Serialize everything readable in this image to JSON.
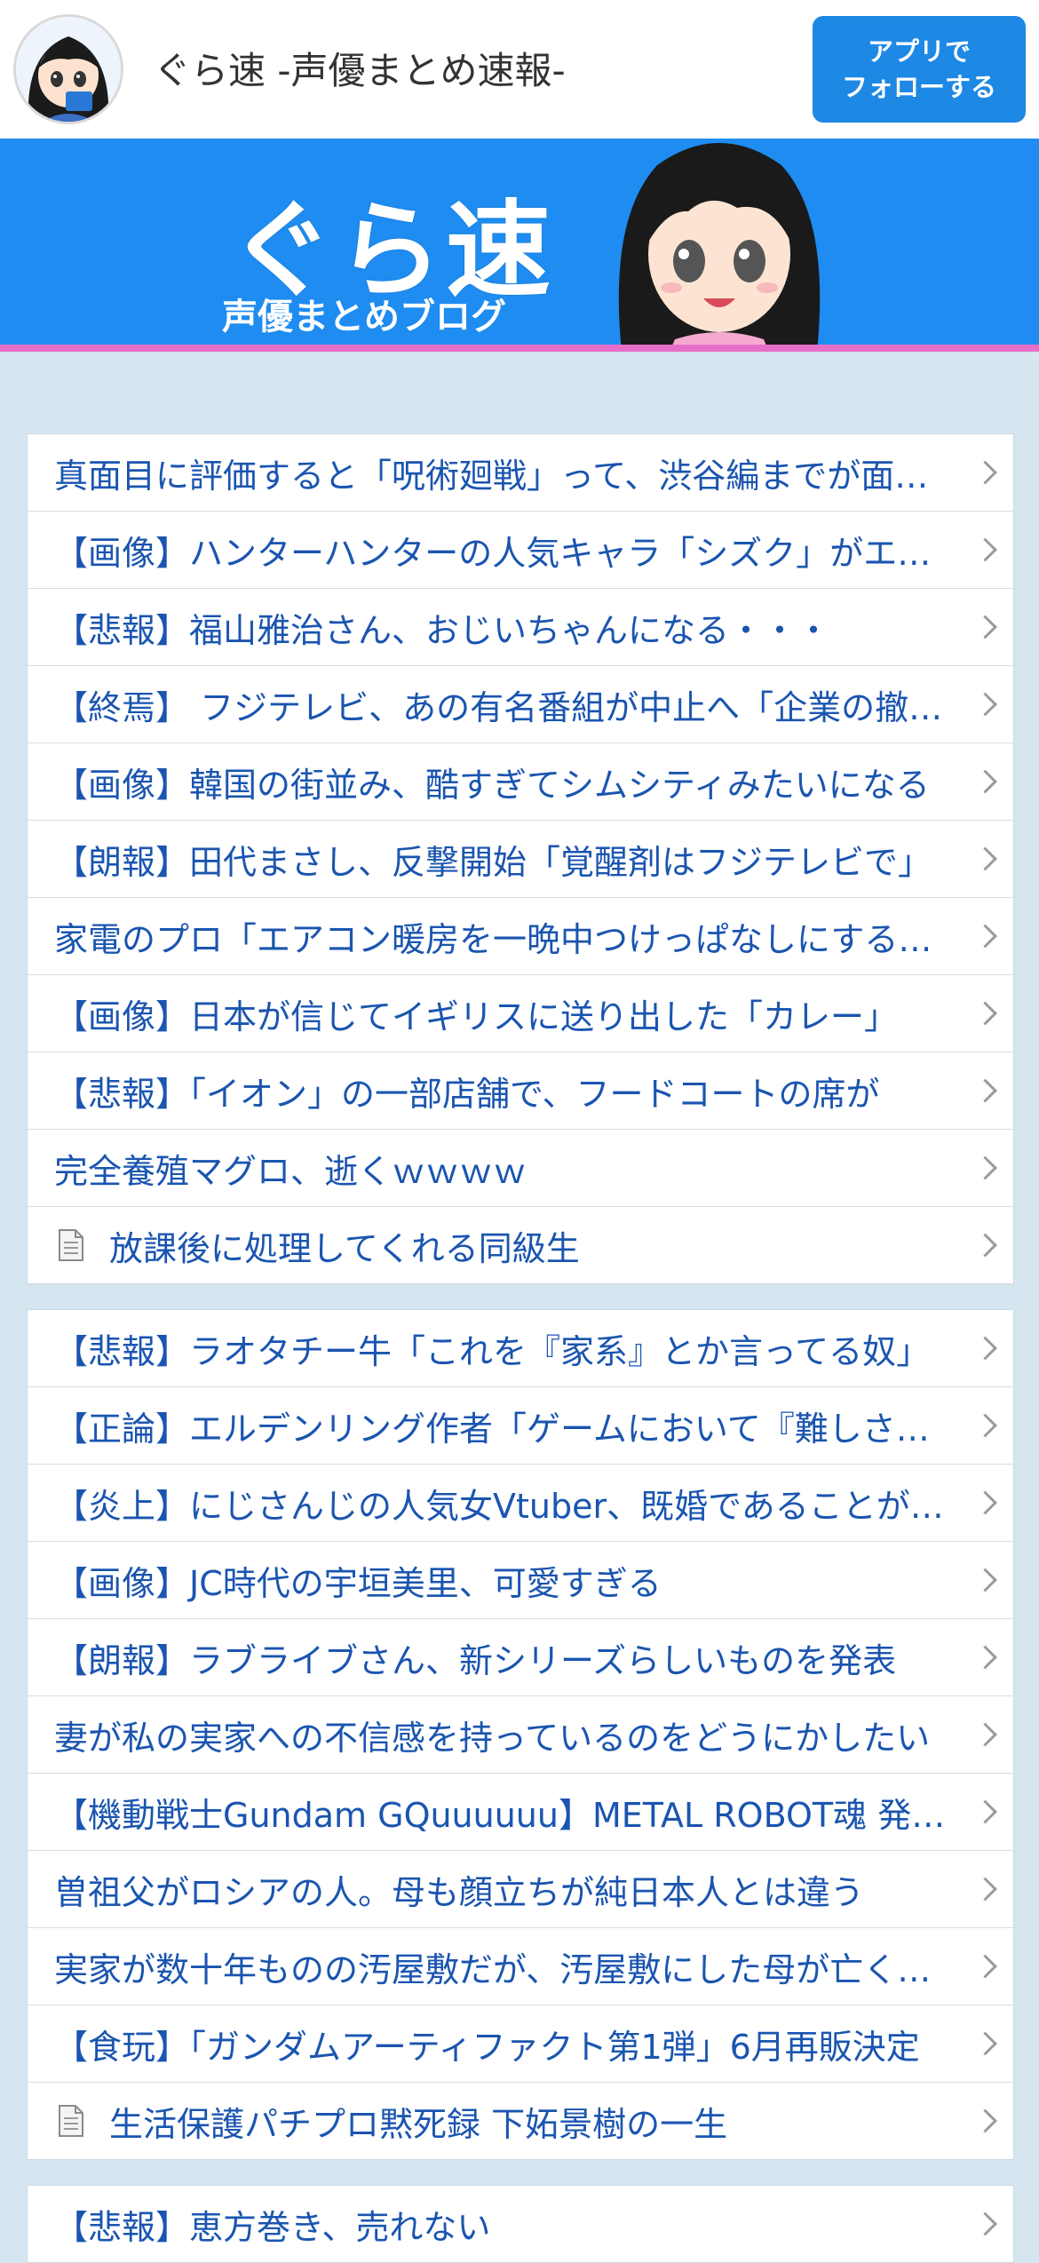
{
  "header": {
    "site_title": "ぐら速 -声優まとめ速報-",
    "follow_button": "アプリで\nフォローする",
    "follow_line1": "アプリで",
    "follow_line2": "フォローする"
  },
  "banner": {
    "logo": "ぐら速",
    "subtitle": "声優まとめブログ"
  },
  "colors": {
    "page_bg": "#d6e6f0",
    "banner_blue": "#1e8cf0",
    "banner_stripe": "#e86fc9",
    "link": "#1a55b0",
    "button": "#1e88e5"
  },
  "lists": [
    {
      "items": [
        {
          "text": "真面目に評価すると「呪術廻戦」って、渋谷編までが面白いよな",
          "icon": "none"
        },
        {
          "text": "【画像】ハンターハンターの人気キャラ「シズク」がエロすぎる",
          "icon": "none"
        },
        {
          "text": "【悲報】福山雅治さん、おじいちゃんになる・・・",
          "icon": "none"
        },
        {
          "text": "【終焉】 フジテレビ、あの有名番組が中止へ「企業の撤退が」",
          "icon": "none"
        },
        {
          "text": "【画像】韓国の街並み、酷すぎてシムシティみたいになる",
          "icon": "none"
        },
        {
          "text": "【朗報】田代まさし、反撃開始「覚醒剤はフジテレビで」",
          "icon": "none"
        },
        {
          "text": "家電のプロ「エアコン暖房を一晩中つけっぱなしにすると」",
          "icon": "none"
        },
        {
          "text": "【画像】日本が信じてイギリスに送り出した「カレー」",
          "icon": "none"
        },
        {
          "text": "【悲報】「イオン」の一部店舗で、フードコートの席が",
          "icon": "none"
        },
        {
          "text": "完全養殖マグロ、逝くｗｗｗｗ",
          "icon": "none"
        },
        {
          "text": "放課後に処理してくれる同級生",
          "icon": "document-icon"
        }
      ]
    },
    {
      "items": [
        {
          "text": "【悲報】ラオタチー牛「これを『家系』とか言ってる奴」",
          "icon": "none"
        },
        {
          "text": "【正論】エルデンリング作者「ゲームにおいて『難しさ』は」",
          "icon": "none"
        },
        {
          "text": "【炎上】にじさんじの人気女Vtuber、既婚であることが判明",
          "icon": "none"
        },
        {
          "text": "【画像】JC時代の宇垣美里、可愛すぎる",
          "icon": "none"
        },
        {
          "text": "【朗報】ラブライブさん、新シリーズらしいものを発表",
          "icon": "none"
        },
        {
          "text": "妻が私の実家への不信感を持っているのをどうにかしたい",
          "icon": "none"
        },
        {
          "text": "【機動戦士Gundam GQuuuuuu】METAL ROBOT魂 発売決定",
          "icon": "none"
        },
        {
          "text": "曽祖父がロシアの人。母も顔立ちが純日本人とは違う",
          "icon": "none"
        },
        {
          "text": "実家が数十年ものの汚屋敷だが、汚屋敷にした母が亡くなり",
          "icon": "none"
        },
        {
          "text": "【食玩】「ガンダムアーティファクト第1弾」6月再販決定",
          "icon": "none"
        },
        {
          "text": "生活保護パチプロ黙死録 下妬景樹の一生",
          "icon": "document-icon"
        }
      ]
    },
    {
      "items": [
        {
          "text": "【悲報】恵方巻き、売れない",
          "icon": "none"
        }
      ]
    }
  ]
}
